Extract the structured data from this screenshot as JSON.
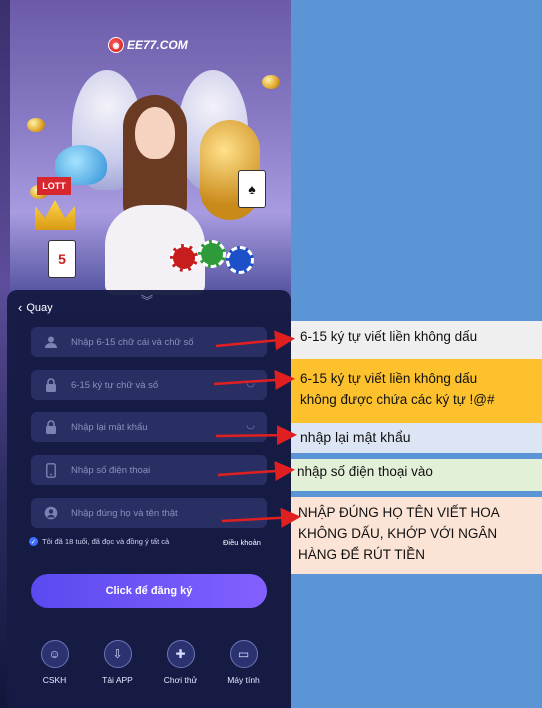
{
  "brand": {
    "logo_text": "EE77.COM"
  },
  "form": {
    "back_label": "Quay",
    "fields": [
      {
        "placeholder": "Nhập 6-15 chữ cái và chữ số",
        "icon": "user-icon"
      },
      {
        "placeholder": "6-15 ký tự chữ và số",
        "icon": "lock-icon"
      },
      {
        "placeholder": "Nhập lại mật khẩu",
        "icon": "lock-icon"
      },
      {
        "placeholder": "Nhập số điện thoại",
        "icon": "phone-icon"
      },
      {
        "placeholder": "Nhập đúng họ và tên thật",
        "icon": "person-icon"
      }
    ],
    "agree_text": "Tôi đã 18 tuổi, đã đọc và đồng ý tất cả",
    "terms_link": "Điều khoản",
    "register_button": "Click để đăng ký"
  },
  "bottom_nav": [
    {
      "label": "CSKH",
      "icon": "support-icon"
    },
    {
      "label": "Tải APP",
      "icon": "download-icon"
    },
    {
      "label": "Chơi thử",
      "icon": "gamepad-icon"
    },
    {
      "label": "Máy tính",
      "icon": "computer-icon"
    }
  ],
  "annotations": {
    "note_username": "6-15 ký tự viết liền không dấu",
    "note_password_line1": "6-15 ký tự viết liền không dấu",
    "note_password_line2": "không được chứa các ký tự !@#",
    "note_confirm": "nhập lại mật khẩu",
    "note_phone": "nhập số điện thoại  vào",
    "note_name_line1": "NHẬP ĐÚNG HỌ TÊN VIẾT HOA",
    "note_name_line2": "KHÔNG DẤU, KHỚP VỚI NGÂN",
    "note_name_line3": "HÀNG ĐỂ RÚT TIỀN"
  },
  "colors": {
    "page_background": "#5b95d6",
    "panel": "#161b44",
    "field": "#2a2f63",
    "button_start": "#5a4af0",
    "button_end": "#8360ff",
    "arrow": "#e02020",
    "note_gray": "#efefef",
    "note_orange": "#fcc12d",
    "note_blue": "#dbe5f4",
    "note_green": "#e2f0d8",
    "note_peach": "#fbe3d6"
  }
}
